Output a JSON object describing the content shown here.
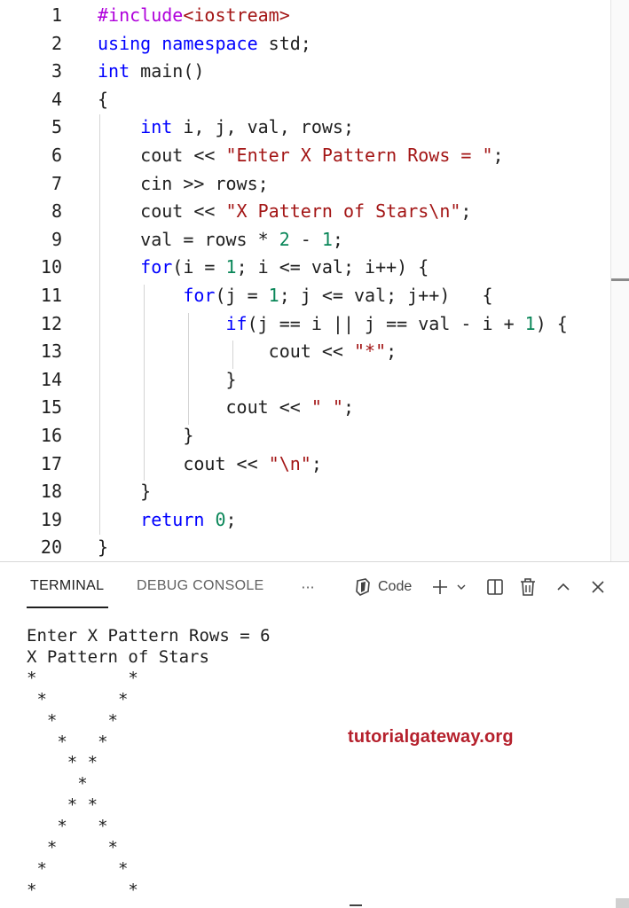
{
  "editor": {
    "lines": [
      {
        "n": "1",
        "tokens": [
          {
            "t": "#include",
            "c": "pp"
          },
          {
            "t": "<iostream>",
            "c": "inc"
          }
        ]
      },
      {
        "n": "2",
        "tokens": [
          {
            "t": "using namespace ",
            "c": "kw"
          },
          {
            "t": "std;",
            "c": "plain"
          }
        ]
      },
      {
        "n": "3",
        "tokens": [
          {
            "t": "int ",
            "c": "kw"
          },
          {
            "t": "main()",
            "c": "plain"
          }
        ]
      },
      {
        "n": "4",
        "tokens": [
          {
            "t": "{",
            "c": "plain"
          }
        ]
      },
      {
        "n": "5",
        "tokens": [
          {
            "t": "    ",
            "c": "plain"
          },
          {
            "t": "int ",
            "c": "kw"
          },
          {
            "t": "i, j, val, rows;",
            "c": "plain"
          }
        ]
      },
      {
        "n": "6",
        "tokens": [
          {
            "t": "    cout << ",
            "c": "plain"
          },
          {
            "t": "\"Enter X Pattern Rows = \"",
            "c": "str"
          },
          {
            "t": ";",
            "c": "plain"
          }
        ]
      },
      {
        "n": "7",
        "tokens": [
          {
            "t": "    cin >> rows;",
            "c": "plain"
          }
        ]
      },
      {
        "n": "8",
        "tokens": [
          {
            "t": "    cout << ",
            "c": "plain"
          },
          {
            "t": "\"X Pattern of Stars\\n\"",
            "c": "str"
          },
          {
            "t": ";",
            "c": "plain"
          }
        ]
      },
      {
        "n": "9",
        "tokens": [
          {
            "t": "    val = rows * ",
            "c": "plain"
          },
          {
            "t": "2",
            "c": "num"
          },
          {
            "t": " - ",
            "c": "plain"
          },
          {
            "t": "1",
            "c": "num"
          },
          {
            "t": ";",
            "c": "plain"
          }
        ]
      },
      {
        "n": "10",
        "tokens": [
          {
            "t": "    ",
            "c": "plain"
          },
          {
            "t": "for",
            "c": "kw"
          },
          {
            "t": "(i = ",
            "c": "plain"
          },
          {
            "t": "1",
            "c": "num"
          },
          {
            "t": "; i <= val; i++) {",
            "c": "plain"
          }
        ]
      },
      {
        "n": "11",
        "tokens": [
          {
            "t": "        ",
            "c": "plain"
          },
          {
            "t": "for",
            "c": "kw"
          },
          {
            "t": "(j = ",
            "c": "plain"
          },
          {
            "t": "1",
            "c": "num"
          },
          {
            "t": "; j <= val; j++)   {",
            "c": "plain"
          }
        ]
      },
      {
        "n": "12",
        "tokens": [
          {
            "t": "            ",
            "c": "plain"
          },
          {
            "t": "if",
            "c": "kw"
          },
          {
            "t": "(j == i || j == val - i + ",
            "c": "plain"
          },
          {
            "t": "1",
            "c": "num"
          },
          {
            "t": ") {",
            "c": "plain"
          }
        ]
      },
      {
        "n": "13",
        "tokens": [
          {
            "t": "                cout << ",
            "c": "plain"
          },
          {
            "t": "\"*\"",
            "c": "str"
          },
          {
            "t": ";",
            "c": "plain"
          }
        ]
      },
      {
        "n": "14",
        "tokens": [
          {
            "t": "            }",
            "c": "plain"
          }
        ]
      },
      {
        "n": "15",
        "tokens": [
          {
            "t": "            cout << ",
            "c": "plain"
          },
          {
            "t": "\" \"",
            "c": "str"
          },
          {
            "t": ";",
            "c": "plain"
          }
        ]
      },
      {
        "n": "16",
        "tokens": [
          {
            "t": "        }",
            "c": "plain"
          }
        ]
      },
      {
        "n": "17",
        "tokens": [
          {
            "t": "        cout << ",
            "c": "plain"
          },
          {
            "t": "\"\\n\"",
            "c": "str"
          },
          {
            "t": ";",
            "c": "plain"
          }
        ]
      },
      {
        "n": "18",
        "tokens": [
          {
            "t": "    }",
            "c": "plain"
          }
        ]
      },
      {
        "n": "19",
        "tokens": [
          {
            "t": "    ",
            "c": "plain"
          },
          {
            "t": "return ",
            "c": "kw"
          },
          {
            "t": "0",
            "c": "num"
          },
          {
            "t": ";",
            "c": "plain"
          }
        ]
      },
      {
        "n": "20",
        "tokens": [
          {
            "t": "}",
            "c": "plain"
          }
        ]
      }
    ]
  },
  "panel": {
    "tabs": [
      {
        "label": "TERMINAL",
        "active": true
      },
      {
        "label": "DEBUG CONSOLE",
        "active": false
      }
    ],
    "more_label": "···",
    "code_label": "Code",
    "icons": {
      "more": "more-icon",
      "shell": "shell-icon",
      "add": "plus-icon",
      "dropdown": "chevron-down-icon",
      "split": "split-icon",
      "trash": "trash-icon",
      "maximize": "chevron-up-icon",
      "close": "close-icon"
    }
  },
  "terminal": {
    "lines": [
      "Enter X Pattern Rows = 6",
      "X Pattern of Stars",
      "*         *",
      " *       *",
      "  *     *",
      "   *   *",
      "    * *",
      "     *",
      "    * *",
      "   *   *",
      "  *     *",
      " *       *",
      "*         *"
    ]
  },
  "watermark": "tutorialgateway.org",
  "colors": {
    "keyword": "#0000ff",
    "string": "#a31515",
    "number": "#098658",
    "preprocessor": "#af00db",
    "watermark": "#b5202c"
  }
}
